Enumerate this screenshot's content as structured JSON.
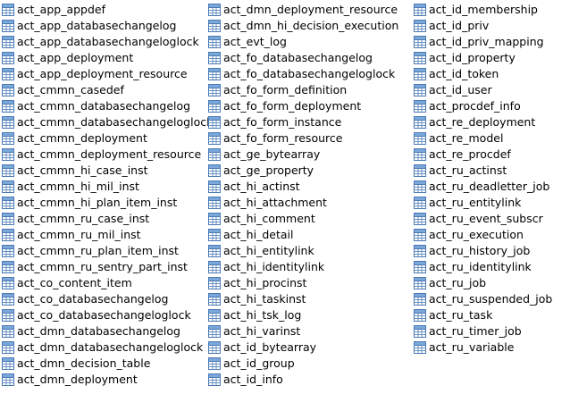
{
  "tables": {
    "columns": [
      [
        "act_app_appdef",
        "act_app_databasechangelog",
        "act_app_databasechangeloglock",
        "act_app_deployment",
        "act_app_deployment_resource",
        "act_cmmn_casedef",
        "act_cmmn_databasechangelog",
        "act_cmmn_databasechangeloglock",
        "act_cmmn_deployment",
        "act_cmmn_deployment_resource",
        "act_cmmn_hi_case_inst",
        "act_cmmn_hi_mil_inst",
        "act_cmmn_hi_plan_item_inst",
        "act_cmmn_ru_case_inst",
        "act_cmmn_ru_mil_inst",
        "act_cmmn_ru_plan_item_inst",
        "act_cmmn_ru_sentry_part_inst",
        "act_co_content_item",
        "act_co_databasechangelog",
        "act_co_databasechangeloglock",
        "act_dmn_databasechangelog",
        "act_dmn_databasechangeloglock",
        "act_dmn_decision_table",
        "act_dmn_deployment"
      ],
      [
        "act_dmn_deployment_resource",
        "act_dmn_hi_decision_execution",
        "act_evt_log",
        "act_fo_databasechangelog",
        "act_fo_databasechangeloglock",
        "act_fo_form_definition",
        "act_fo_form_deployment",
        "act_fo_form_instance",
        "act_fo_form_resource",
        "act_ge_bytearray",
        "act_ge_property",
        "act_hi_actinst",
        "act_hi_attachment",
        "act_hi_comment",
        "act_hi_detail",
        "act_hi_entitylink",
        "act_hi_identitylink",
        "act_hi_procinst",
        "act_hi_taskinst",
        "act_hi_tsk_log",
        "act_hi_varinst",
        "act_id_bytearray",
        "act_id_group",
        "act_id_info"
      ],
      [
        "act_id_membership",
        "act_id_priv",
        "act_id_priv_mapping",
        "act_id_property",
        "act_id_token",
        "act_id_user",
        "act_procdef_info",
        "act_re_deployment",
        "act_re_model",
        "act_re_procdef",
        "act_ru_actinst",
        "act_ru_deadletter_job",
        "act_ru_entitylink",
        "act_ru_event_subscr",
        "act_ru_execution",
        "act_ru_history_job",
        "act_ru_identitylink",
        "act_ru_job",
        "act_ru_suspended_job",
        "act_ru_task",
        "act_ru_timer_job",
        "act_ru_variable"
      ]
    ],
    "icon": "table-icon",
    "colors": {
      "icon_border": "#4a7ab5",
      "icon_header": "#7ba7d9",
      "icon_fill": "#ffffff",
      "text": "#000000"
    }
  }
}
